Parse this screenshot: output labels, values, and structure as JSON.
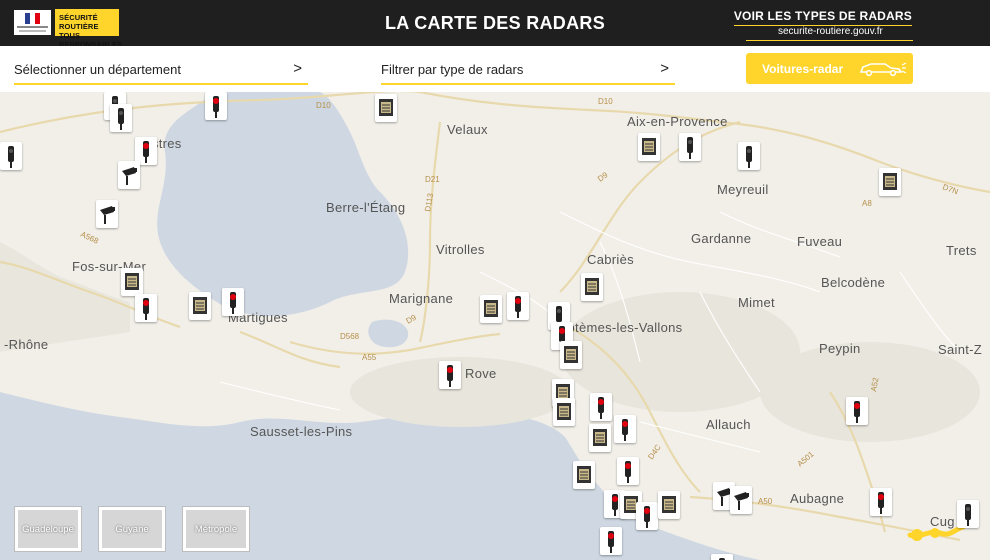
{
  "header": {
    "logo_text": "Sécurité routière tous responsables",
    "title": "LA CARTE DES RADARS",
    "types_link": "VOIR LES TYPES DE RADARS",
    "site": "securite-routiere.gouv.fr"
  },
  "filters": {
    "department_label": "Sélectionner un département",
    "type_label": "Filtrer par type de radars",
    "voitures_radar_label": "Voitures-radar"
  },
  "map": {
    "places": [
      "Velaux",
      "Aix-en-Provence",
      "Meyreuil",
      "Istres",
      "Berre-l'Étang",
      "Vitrolles",
      "Cabriès",
      "Gardanne",
      "Fuveau",
      "Trets",
      "Fos-sur-Mer",
      "Marignane",
      "Mimet",
      "Belcodène",
      "Martigues",
      "Septèmes-les-Vallons",
      "Peypin",
      "Saint-Z",
      "-Rhône",
      "Rove",
      "Allauch",
      "Sausset-les-Pins",
      "Aubagne",
      "Cug"
    ],
    "roads": [
      "D10",
      "D10",
      "D21",
      "D113",
      "D9",
      "A8",
      "D7N",
      "A568",
      "D9",
      "D568",
      "A55",
      "A50",
      "A501",
      "D4C",
      "A52"
    ]
  },
  "territories": [
    "Guadeloupe",
    "Guyane",
    "Métropole"
  ],
  "colors": {
    "accent": "#ffd52b",
    "header_bg": "#1f1f1f",
    "sea": "#cfd8e2",
    "land": "#f2efe9"
  }
}
